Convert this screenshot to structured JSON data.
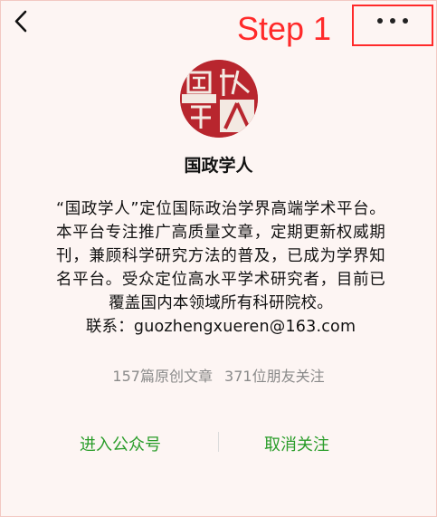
{
  "annotation": {
    "step_label": "Step 1"
  },
  "nav": {
    "back_icon": "chevron-left-icon",
    "more_icon": "more-dots-icon"
  },
  "account": {
    "logo_text": "国政学人",
    "name": "国政学人",
    "description": "“国政学人”定位国际政治学界高端学术平台。本平台专注推广高质量文章，定期更新权威期刊，兼顾科学研究方法的普及，已成为学界知名平台。受众定位高水平学术研究者，目前已覆盖国内本领域所有科研院校。",
    "contact": "联系：guozhengxueren@163.com",
    "articles": "157篇原创文章",
    "friends": "371位朋友关注"
  },
  "actions": {
    "enter": "进入公众号",
    "unfollow": "取消关注"
  },
  "colors": {
    "accent_green": "#2a9d2a",
    "annotation_red": "#ff2a2a",
    "seal_red": "#b8262e"
  }
}
